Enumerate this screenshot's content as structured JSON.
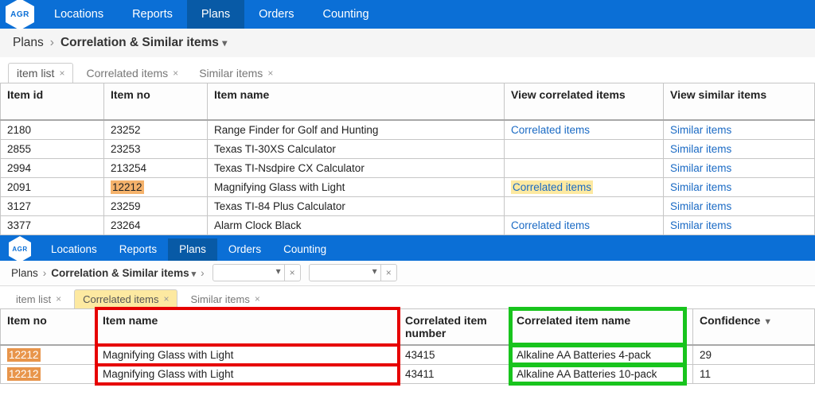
{
  "brand": "AGR",
  "nav": {
    "items": [
      "Locations",
      "Reports",
      "Plans",
      "Orders",
      "Counting"
    ],
    "active": "Plans"
  },
  "breadcrumb": {
    "root": "Plans",
    "page": "Correlation & Similar items"
  },
  "tabs1": {
    "item_list": "item list",
    "correlated": "Correlated items",
    "similar": "Similar items"
  },
  "columns1": {
    "item_id": "Item id",
    "item_no": "Item no",
    "item_name": "Item name",
    "view_corr": "View correlated items",
    "view_sim": "View similar items"
  },
  "linklabels": {
    "corr": "Correlated items",
    "sim": "Similar items"
  },
  "rows1": [
    {
      "id": "2180",
      "no": "23252",
      "name": "Range Finder for Golf and Hunting",
      "corr": true,
      "sim": true
    },
    {
      "id": "2855",
      "no": "23253",
      "name": "Texas TI-30XS Calculator",
      "corr": false,
      "sim": true
    },
    {
      "id": "2994",
      "no": "213254",
      "name": "Texas TI-Nsdpire CX Calculator",
      "corr": false,
      "sim": true
    },
    {
      "id": "2091",
      "no": "12212",
      "name": "Magnifying Glass with Light",
      "corr": true,
      "sim": true,
      "hl": true
    },
    {
      "id": "3127",
      "no": "23259",
      "name": "Texas TI-84 Plus Calculator",
      "corr": false,
      "sim": true
    },
    {
      "id": "3377",
      "no": "23264",
      "name": "Alarm Clock Black",
      "corr": true,
      "sim": true
    }
  ],
  "tabs2": {
    "item_list": "item list",
    "correlated": "Correlated items",
    "similar": "Similar items"
  },
  "columns2": {
    "item_no": "Item no",
    "item_name": "Item name",
    "corr_num": "Correlated item number",
    "corr_name": "Correlated item name",
    "conf": "Confidence"
  },
  "rows2": [
    {
      "no": "12212",
      "name": "Magnifying Glass with Light",
      "cnum": "43415",
      "cname": "Alkaline AA Batteries 4-pack",
      "conf": "29"
    },
    {
      "no": "12212",
      "name": "Magnifying Glass with Light",
      "cnum": "43411",
      "cname": "Alkaline AA Batteries 10-pack",
      "conf": "11"
    }
  ]
}
